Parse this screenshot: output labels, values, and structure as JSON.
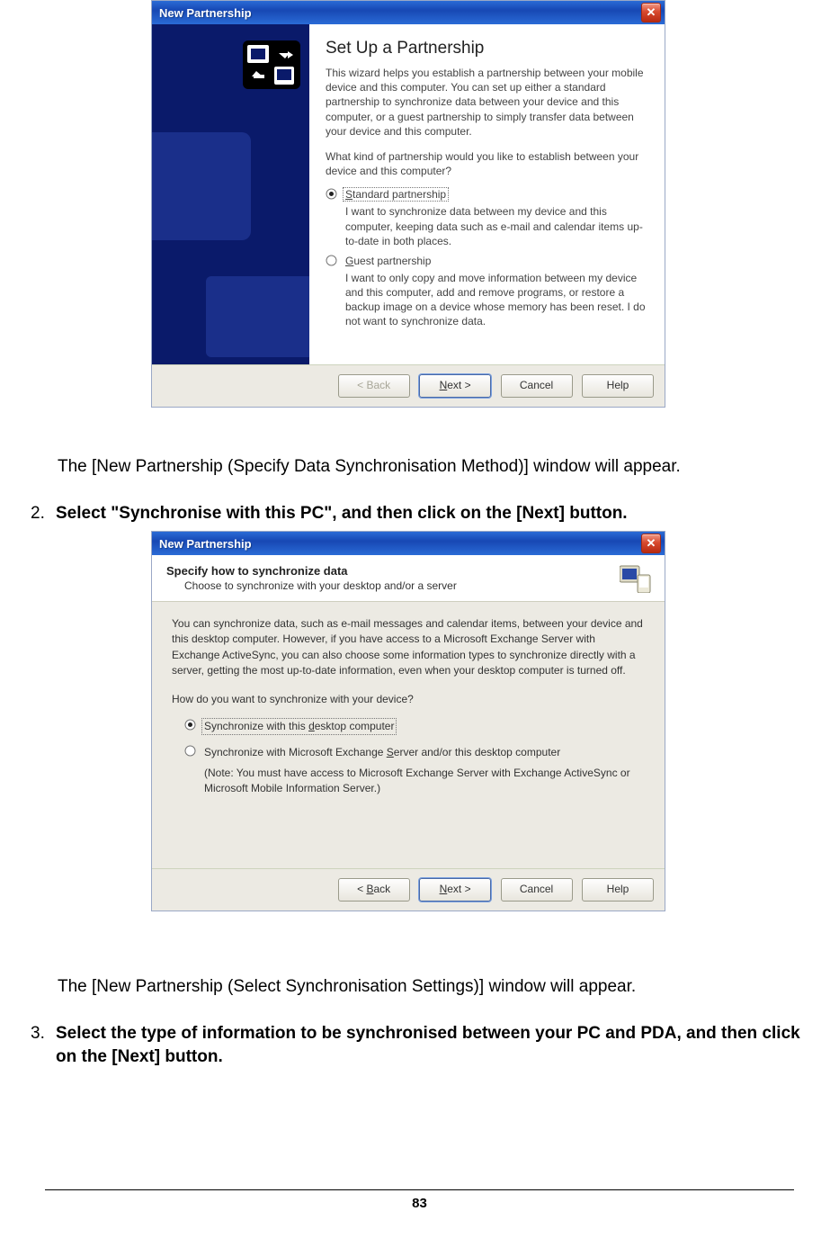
{
  "dialog1": {
    "title": "New Partnership",
    "heading": "Set Up a Partnership",
    "intro": "This wizard helps you establish a partnership between your mobile device and this computer. You can set up either a standard partnership to synchronize data between your device and this computer, or a guest partnership to simply transfer data between your device and this computer.",
    "question": "What kind of partnership would you like to establish between your device and this computer?",
    "opt1_label": "Standard partnership",
    "opt1_desc": "I want to synchronize data between my device and this computer, keeping data such as e-mail and calendar items up-to-date in both places.",
    "opt2_label": "Guest partnership",
    "opt2_desc": "I want to only copy and move information between my device and this computer, add and remove programs, or restore a backup image on a device whose memory has been reset. I do not want to synchronize data.",
    "btn_back": "< Back",
    "btn_next": "Next >",
    "btn_cancel": "Cancel",
    "btn_help": "Help"
  },
  "text_after1": "The [New Partnership (Specify Data Synchronisation Method)] window will appear.",
  "step2_num": "2.",
  "step2_text": "Select \"Synchronise with this PC\", and then click on the [Next] button.",
  "dialog2": {
    "title": "New Partnership",
    "hs_title": "Specify how to synchronize data",
    "hs_sub": "Choose to synchronize with your desktop and/or a server",
    "para": "You can synchronize data, such as e-mail messages and calendar items, between your device and this desktop computer. However, if you have access to a Microsoft Exchange Server with Exchange ActiveSync, you can also choose some information types to synchronize directly with a server, getting the most up-to-date information, even when your desktop computer is turned off.",
    "question": "How do you want to synchronize with your device?",
    "opt1_label": "Synchronize with this desktop computer",
    "opt2_label": "Synchronize with Microsoft Exchange Server and/or this desktop computer",
    "opt2_note": "(Note: You must have access to Microsoft Exchange Server with Exchange ActiveSync or Microsoft Mobile Information Server.)",
    "btn_back": "< Back",
    "btn_next": "Next >",
    "btn_cancel": "Cancel",
    "btn_help": "Help"
  },
  "text_after2": "The [New Partnership (Select Synchronisation Settings)] window will appear.",
  "step3_num": "3.",
  "step3_text": "Select the type of information to be synchronised between your PC and PDA, and then click on the [Next] button.",
  "page_number": "83"
}
